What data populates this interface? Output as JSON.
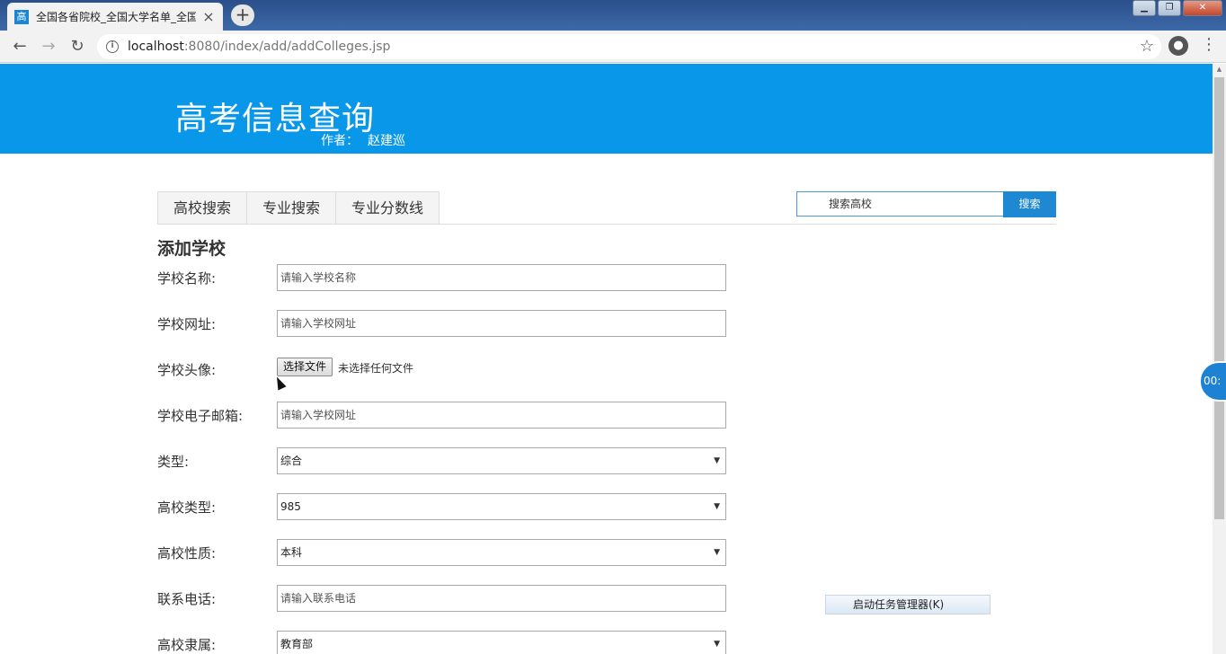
{
  "browser": {
    "tab_favicon": "高",
    "tab_title": "全国各省院校_全国大学名单_全国",
    "tab_close": "×",
    "new_tab": "+",
    "window_controls": [
      "▁",
      "❐",
      "✕"
    ],
    "back": "←",
    "forward": "→",
    "reload": "↻",
    "url_host": "localhost",
    "url_path": ":8080/index/add/addColleges.jsp",
    "info_icon": "i",
    "star_icon": "☆",
    "account_icon": "●",
    "menu_icon": "⋮"
  },
  "banner": {
    "title": "高考信息查询",
    "author_label": "作者：",
    "author_name": "赵建巡",
    "color": "#0997ea"
  },
  "nav_tabs": [
    "高校搜索",
    "专业搜索",
    "专业分数线"
  ],
  "search": {
    "value": "搜索高校",
    "button": "搜索"
  },
  "form": {
    "heading": "添加学校",
    "name_label": "学校名称:",
    "name_placeholder": "请输入学校名称",
    "url_label": "学校网址:",
    "url_placeholder": "请输入学校网址",
    "avatar_label": "学校头像:",
    "file_button": "选择文件",
    "file_status": "未选择任何文件",
    "email_label": "学校电子邮箱:",
    "email_placeholder": "请输入学校网址",
    "type_label": "类型:",
    "type_value": "综合",
    "college_type_label": "高校类型:",
    "college_type_value": "985",
    "nature_label": "高校性质:",
    "nature_value": "本科",
    "phone_label": "联系电话:",
    "phone_placeholder": "请输入联系电话",
    "affiliation_label": "高校隶属:",
    "affiliation_value": "教育部",
    "select_arrow": "▼"
  },
  "context_menu": {
    "item": "启动任务管理器(K)"
  },
  "overlay": {
    "timer": "00:",
    "scroll_up": "▲"
  }
}
